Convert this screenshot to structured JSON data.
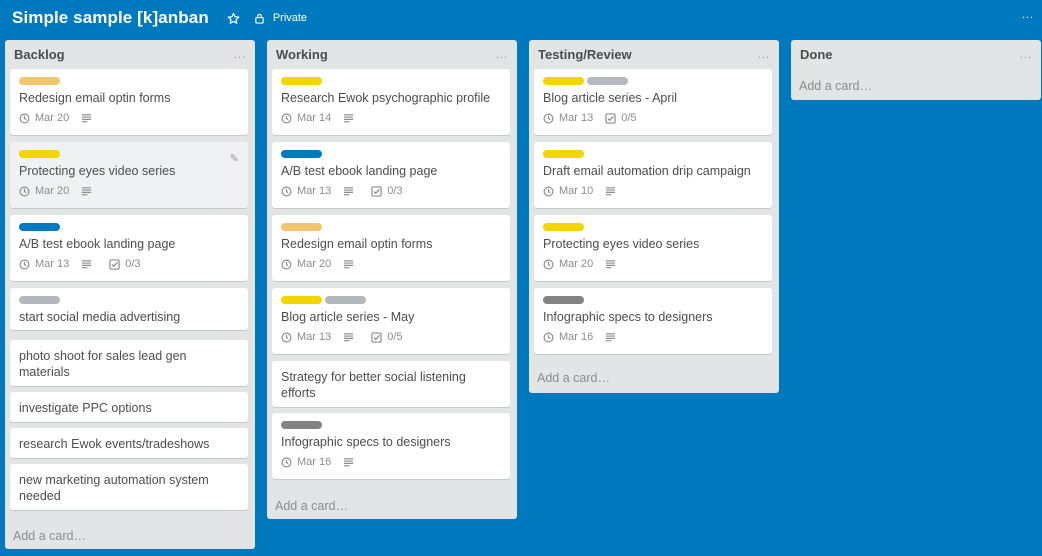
{
  "board": {
    "title": "Simple sample [k]anban",
    "visibility": "Private",
    "menu": "...",
    "background_color": "#0079bf"
  },
  "label_colors": {
    "orange": "#f2c56f",
    "yellow": "#f3d600",
    "blue": "#0079bf",
    "gray": "#b3b8bd",
    "dark_gray": "#838383"
  },
  "add_card_label": "Add a card…",
  "list_menu": "...",
  "lists": [
    {
      "title": "Backlog",
      "cards": [
        {
          "title": "Redesign email optin forms",
          "labels": [
            "orange"
          ],
          "due": "Mar 20",
          "has_description": true
        },
        {
          "title": "Protecting eyes video series",
          "labels": [
            "yellow"
          ],
          "due": "Mar 20",
          "has_description": true
        },
        {
          "title": "A/B test ebook landing page",
          "labels": [
            "blue"
          ],
          "due": "Mar 13",
          "has_description": true,
          "checklist": "0/3"
        },
        {
          "title": "start social media advertising",
          "labels": [
            "gray"
          ]
        },
        {
          "title": "photo shoot for sales lead gen materials",
          "labels": []
        },
        {
          "title": "investigate PPC options",
          "labels": []
        },
        {
          "title": "research Ewok events/tradeshows",
          "labels": []
        },
        {
          "title": "new marketing automation system needed",
          "labels": []
        }
      ]
    },
    {
      "title": "Working",
      "cards": [
        {
          "title": "Research Ewok psychographic profile",
          "labels": [
            "yellow"
          ],
          "due": "Mar 14",
          "has_description": true
        },
        {
          "title": "A/B test ebook landing page",
          "labels": [
            "blue"
          ],
          "due": "Mar 13",
          "has_description": true,
          "checklist": "0/3"
        },
        {
          "title": "Redesign email optin forms",
          "labels": [
            "orange"
          ],
          "due": "Mar 20",
          "has_description": true
        },
        {
          "title": "Blog article series - May",
          "labels": [
            "yellow",
            "gray"
          ],
          "due": "Mar 13",
          "has_description": true,
          "checklist": "0/5"
        },
        {
          "title": "Strategy for better social listening efforts",
          "labels": []
        },
        {
          "title": "Infographic specs to designers",
          "labels": [
            "dark_gray"
          ],
          "due": "Mar 16",
          "has_description": true
        }
      ]
    },
    {
      "title": "Testing/Review",
      "cards": [
        {
          "title": "Blog article series - April",
          "labels": [
            "yellow",
            "gray"
          ],
          "due": "Mar 13",
          "checklist": "0/5"
        },
        {
          "title": "Draft email automation drip campaign",
          "labels": [
            "yellow"
          ],
          "due": "Mar 10",
          "has_description": true
        },
        {
          "title": "Protecting eyes video series",
          "labels": [
            "yellow"
          ],
          "due": "Mar 20",
          "has_description": true
        },
        {
          "title": "Infographic specs to designers",
          "labels": [
            "dark_gray"
          ],
          "due": "Mar 16",
          "has_description": true
        }
      ]
    },
    {
      "title": "Done",
      "cards": []
    }
  ]
}
